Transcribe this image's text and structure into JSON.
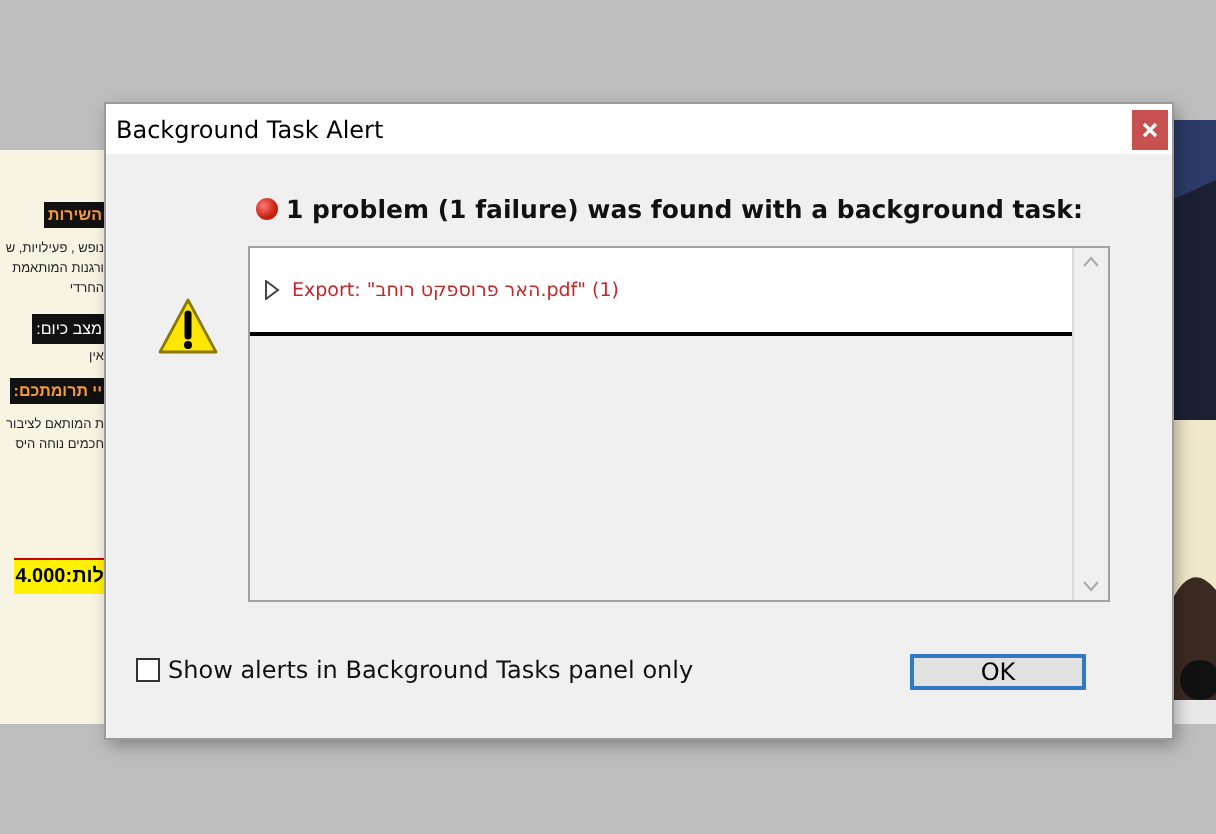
{
  "document": {
    "left_texts": [
      {
        "kind": "heading",
        "text": "השירות"
      },
      {
        "kind": "body",
        "text": "נופש , פעילויות, ש"
      },
      {
        "kind": "body",
        "text": "ורגנות המותאמת"
      },
      {
        "kind": "body",
        "text": "החרדי"
      },
      {
        "kind": "banner",
        "text": "מצב כיום:"
      },
      {
        "kind": "body",
        "text": "אין"
      },
      {
        "kind": "heading",
        "text": "יי תרומתכם:"
      },
      {
        "kind": "body",
        "text": "ת המותאם לציבור"
      },
      {
        "kind": "body",
        "text": "חכמים נוחה היס"
      },
      {
        "kind": "price",
        "text": "לות:4.000"
      }
    ]
  },
  "window": {
    "title": "Background Task Alert"
  },
  "summary": "1 problem (1 failure) was found with a background task:",
  "problems": [
    {
      "text": "Export: \"האר פרוספקט רוחב.pdf\" (1)",
      "expanded": false
    }
  ],
  "option": {
    "label": "Show alerts in Background Tasks panel only",
    "checked": false
  },
  "buttons": [
    "OK"
  ]
}
